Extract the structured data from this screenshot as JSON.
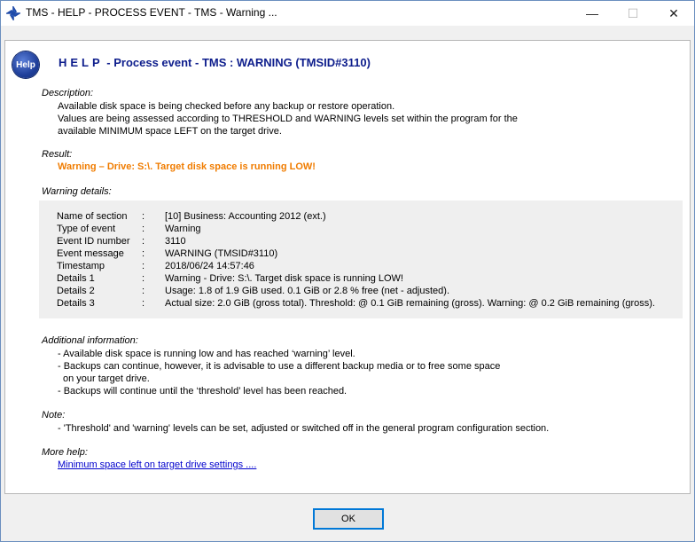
{
  "window": {
    "title": "TMS - HELP - PROCESS EVENT - TMS - Warning ...",
    "controls": {
      "minimize": "—",
      "maximize": "☐",
      "close": "✕"
    }
  },
  "help_badge": {
    "label": "Help"
  },
  "heading": {
    "spaced": "HELP",
    "rest": " - Process event - TMS : WARNING (TMSID#3110)"
  },
  "description": {
    "label": "Description:",
    "lines": [
      "Available disk space is being checked before any backup or restore operation.",
      "Values are being assessed according to THRESHOLD and WARNING levels set within the program for the",
      "available MINIMUM space LEFT on the target drive."
    ]
  },
  "result": {
    "label": "Result:",
    "text": "Warning – Drive: S:\\. Target disk space is running LOW!",
    "color": "#f07c00"
  },
  "warning_details": {
    "label": "Warning details:",
    "separator": ":",
    "rows": [
      {
        "key": "Name of section",
        "value": "[10] Business: Accounting 2012 (ext.)"
      },
      {
        "key": "Type of event",
        "value": "Warning"
      },
      {
        "key": "Event ID number",
        "value": "3110"
      },
      {
        "key": "Event message",
        "value": "WARNING (TMSID#3110)"
      },
      {
        "key": "Timestamp",
        "value": "2018/06/24 14:57:46"
      },
      {
        "key": "Details 1",
        "value": "Warning - Drive: S:\\. Target disk space is running LOW!"
      },
      {
        "key": "Details 2",
        "value": "Usage: 1.8 of 1.9 GiB used. 0.1 GiB or 2.8 % free (net - adjusted)."
      },
      {
        "key": "Details 3",
        "value": "Actual size: 2.0 GiB (gross total). Threshold: @ 0.1 GiB remaining (gross). Warning: @ 0.2 GiB remaining (gross)."
      }
    ]
  },
  "additional": {
    "label": "Additional information:",
    "lines": [
      "- Available disk space is running low and has reached ‘warning’ level.",
      "- Backups can continue, however, it is advisable to use a different backup media or to free some space",
      "on your target drive.",
      "- Backups will continue until the ‘threshold’ level has been reached."
    ]
  },
  "note": {
    "label": "Note:",
    "text": "- 'Threshold' and 'warning' levels can be set, adjusted or switched off in the general program configuration section."
  },
  "more_help": {
    "label": "More help:",
    "link": "Minimum space left on target drive settings ...."
  },
  "ok_button": {
    "label": "OK"
  },
  "colors": {
    "heading": "#0d1d8c",
    "link": "#0000cc",
    "accent_border": "#0078d7"
  }
}
